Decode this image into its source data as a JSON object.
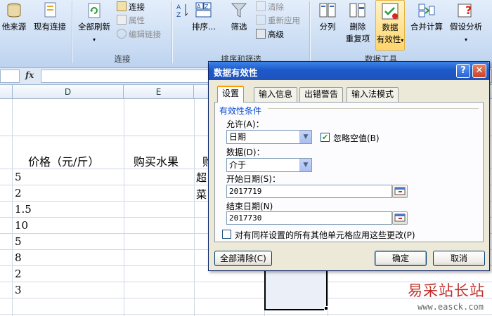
{
  "ribbon": {
    "buttons_big": {
      "from_other_sources": "他来源",
      "existing_connections": "现有连接",
      "refresh_all": "全部刷新",
      "sort": "排序...",
      "filter": "筛选",
      "text_to_columns": "分列",
      "remove_duplicates_1": "删除",
      "remove_duplicates_2": "重复项",
      "data_validation_1": "数据",
      "data_validation_2": "有效性",
      "consolidate": "合并计算",
      "what_if_1": "假设分析"
    },
    "buttons_small": {
      "connections": "连接",
      "properties": "属性",
      "edit_links": "编辑链接",
      "clear": "清除",
      "reapply": "重新应用",
      "advanced": "高级"
    },
    "groups": {
      "connections": "连接",
      "sort_filter": "排序和筛选",
      "data_tools": "数据工具"
    }
  },
  "formula_bar": {
    "fx": "fx",
    "value": ""
  },
  "columns": [
    "D",
    "E"
  ],
  "cells": {
    "d_header": "价格（元/斤）",
    "e_header": "购买水果",
    "f_header_partial": "购",
    "f_r1_partial": "超",
    "f_r2_partial": "菜",
    "d_values": [
      "5",
      "2",
      "1.5",
      "10",
      "5",
      "8",
      "2",
      "3"
    ]
  },
  "dialog": {
    "title": "数据有效性",
    "help": "?",
    "close": "✕",
    "tabs": [
      "设置",
      "输入信息",
      "出错警告",
      "输入法模式"
    ],
    "section_title": "有效性条件",
    "allow_label": "允许(A)：",
    "allow_value": "日期",
    "ignore_blank": "忽略空值(B)",
    "data_label": "数据(D)：",
    "data_value": "介于",
    "start_label": "开始日期(S)：",
    "start_value": "2017719",
    "end_label": "结束日期(N)",
    "end_value": "2017730",
    "apply_all": "对有同样设置的所有其他单元格应用这些更改(P)",
    "clear_all": "全部清除(C)",
    "ok": "确定",
    "cancel": "取消"
  },
  "watermark": {
    "text": "易采站长站",
    "url": "www.easck.com"
  }
}
